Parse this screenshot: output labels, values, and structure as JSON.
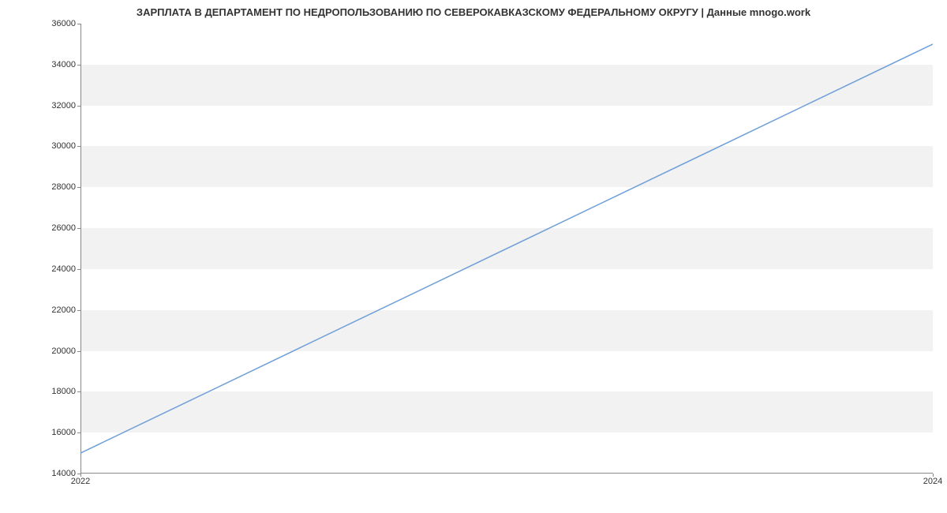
{
  "chart_data": {
    "type": "line",
    "title": "ЗАРПЛАТА В ДЕПАРТАМЕНТ ПО НЕДРОПОЛЬЗОВАНИЮ ПО СЕВЕРОКАВКАЗСКОМУ ФЕДЕРАЛЬНОМУ ОКРУГУ | Данные mnogo.work",
    "x": [
      2022,
      2024
    ],
    "values": [
      15000,
      35000
    ],
    "xlabel": "",
    "ylabel": "",
    "ylim": [
      14000,
      36000
    ],
    "y_ticks": [
      14000,
      16000,
      18000,
      20000,
      22000,
      24000,
      26000,
      28000,
      30000,
      32000,
      34000,
      36000
    ],
    "x_ticks": [
      2022,
      2024
    ],
    "line_color": "#6f9fd8",
    "grid_band_color": "#f2f2f2"
  }
}
